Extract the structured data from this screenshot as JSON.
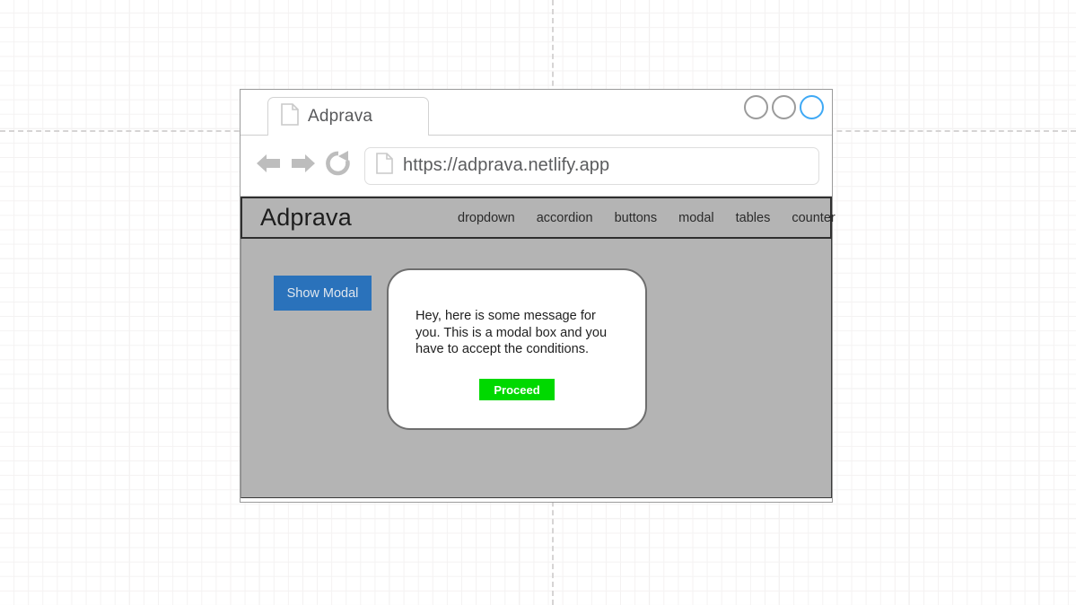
{
  "canvas": {
    "background_color": "#ffffff",
    "grid_minor_color": "#f4f2f2",
    "grid_major_color": "#e8e8e8",
    "guide_color": "#d6d4d4"
  },
  "browser": {
    "tab": {
      "title": "Adprava",
      "icon": "page-icon"
    },
    "window_controls": [
      {
        "name": "minimize",
        "color": "#9b9b9b",
        "active": false
      },
      {
        "name": "maximize",
        "color": "#9b9b9b",
        "active": false
      },
      {
        "name": "close",
        "color": "#3fa9f5",
        "active": true
      }
    ],
    "toolbar": {
      "back_icon": "back-arrow-icon",
      "forward_icon": "forward-arrow-icon",
      "reload_icon": "reload-icon",
      "url_icon": "page-icon",
      "url": "https://adprava.netlify.app"
    }
  },
  "site": {
    "brand": "Adprava",
    "nav_links": [
      {
        "label": "dropdown"
      },
      {
        "label": "accordion"
      },
      {
        "label": "buttons"
      },
      {
        "label": "modal"
      },
      {
        "label": "tables"
      },
      {
        "label": "counter"
      }
    ],
    "nav_background": "#b4b4b4",
    "body_background": "#b4b4b4",
    "show_modal_button": {
      "label": "Show Modal",
      "background": "#2a72bb",
      "text_color": "#dfe6ee"
    },
    "modal": {
      "message": "Hey, here is some message for you. This is a modal box and you have to accept the conditions.",
      "proceed_button": {
        "label": "Proceed",
        "background": "#00d900",
        "text_color": "#ffffff"
      }
    }
  }
}
